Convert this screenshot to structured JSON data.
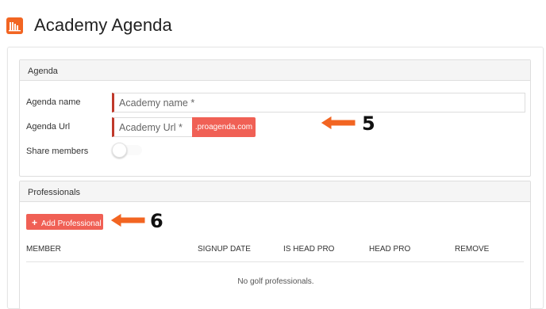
{
  "app": {
    "title": "Academy Agenda",
    "logo_icon": "bar-chart-icon",
    "accent_color": "#f26522"
  },
  "agenda_panel": {
    "heading": "Agenda",
    "name_label": "Agenda name",
    "name_placeholder": "Academy name *",
    "url_label": "Agenda Url",
    "url_placeholder": "Academy Url *",
    "url_suffix": ".proagenda.com",
    "share_label": "Share members",
    "share_enabled": false
  },
  "professionals_panel": {
    "heading": "Professionals",
    "add_button_label": "Add Professional",
    "add_button_icon": "plus-icon",
    "columns": [
      "MEMBER",
      "SIGNUP DATE",
      "IS HEAD PRO",
      "HEAD PRO",
      "REMOVE"
    ],
    "empty_message": "No golf professionals."
  },
  "annotations": [
    {
      "number": "5",
      "color": "#f26522"
    },
    {
      "number": "6",
      "color": "#f26522"
    }
  ]
}
